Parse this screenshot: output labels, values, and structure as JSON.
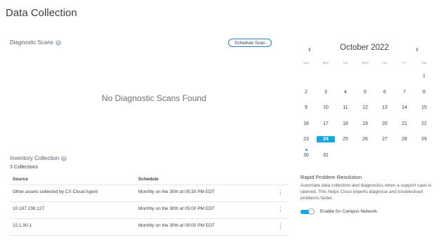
{
  "page": {
    "title": "Data Collection"
  },
  "diagnostic": {
    "title": "Diagnostic Scans",
    "schedule_button": "Schedule Scan",
    "empty_message": "No Diagnostic Scans Found"
  },
  "inventory": {
    "title": "Inventory Collection",
    "count": "3 Collections",
    "columns": [
      "Source",
      "Schedule"
    ],
    "rows": [
      {
        "source": "Other assets collected by CX Cloud Agent",
        "schedule": "Monthly on the 30th at 05:30 PM EDT"
      },
      {
        "source": "10.197.238.127",
        "schedule": "Monthly on the 30th at 05:00 PM EDT"
      },
      {
        "source": "22.1.90.1",
        "schedule": "Monthly on the 30th at 09:00 PM EDT"
      }
    ],
    "row_menu_icon": "more-vertical-icon"
  },
  "calendar": {
    "month_label": "October 2022",
    "prev_icon": "chevron-left-icon",
    "next_icon": "chevron-right-icon",
    "weekdays": [
      "Sun",
      "Mon",
      "Tue",
      "Wed",
      "Thu",
      "Fri",
      "Sat"
    ],
    "weeks": [
      [
        "",
        "",
        "",
        "",
        "",
        "",
        "1"
      ],
      [
        "2",
        "3",
        "4",
        "5",
        "6",
        "7",
        "8"
      ],
      [
        "9",
        "10",
        "11",
        "12",
        "13",
        "14",
        "15"
      ],
      [
        "16",
        "17",
        "18",
        "19",
        "20",
        "21",
        "22"
      ],
      [
        "23",
        "24",
        "25",
        "26",
        "27",
        "28",
        "29"
      ],
      [
        "30",
        "31",
        "",
        "",
        "",
        "",
        ""
      ]
    ],
    "selected_day": "24",
    "marked_day": "30",
    "accent_color": "#16a8dc"
  },
  "rapid": {
    "title": "Rapid Problem Resolution",
    "description": "Automate data collection and diagnostics when a support case is opened. This helps Cisco experts diagnose and troubleshoot problems faster.",
    "toggle_label": "Enable for Campus Network",
    "toggle_on": true
  }
}
